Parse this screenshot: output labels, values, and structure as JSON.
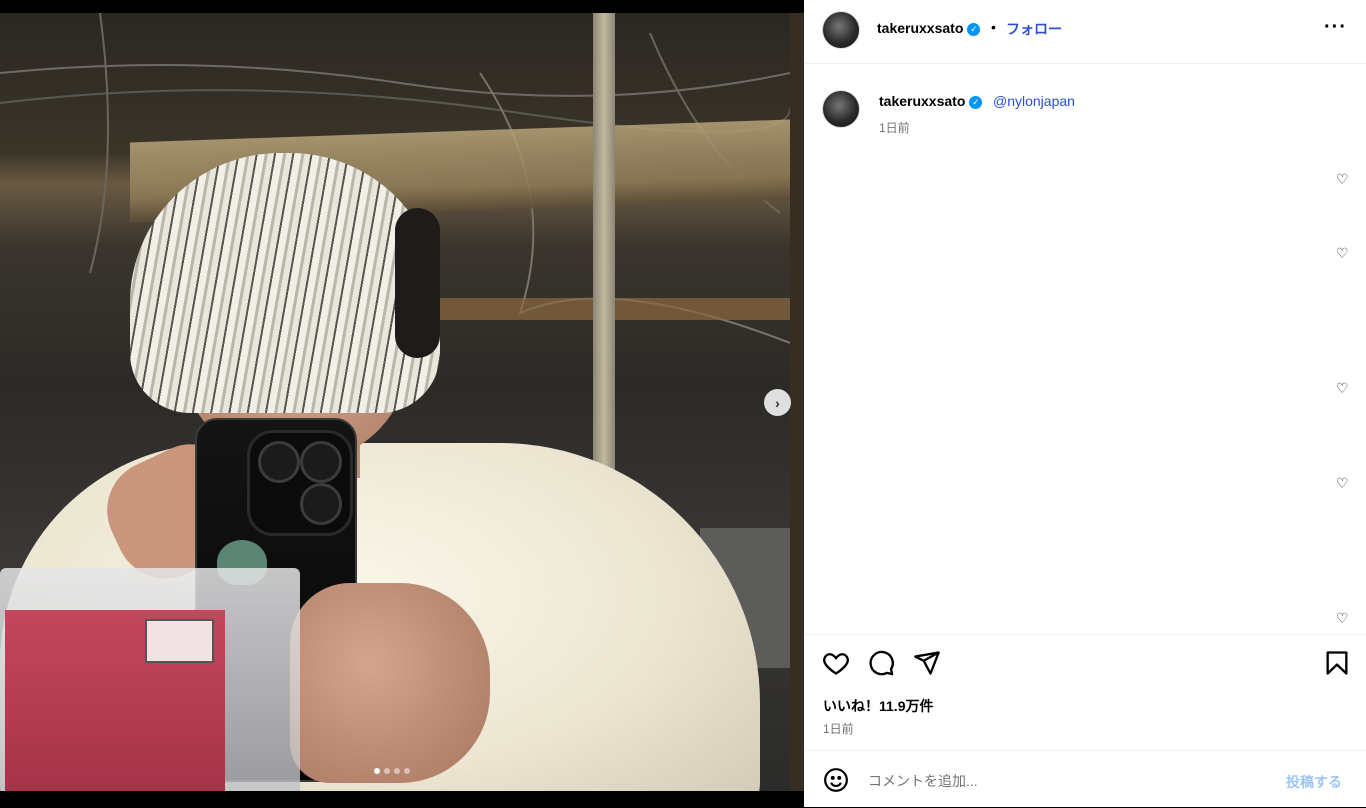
{
  "post": {
    "username": "takeruxxsato",
    "separator": "•",
    "follow_label": "フォロー",
    "more_icon": "more-horizontal-icon",
    "caption_mention": "@nylonjapan",
    "caption_time": "1日前",
    "likes": "いいね！11.9万件",
    "date": "1日前"
  },
  "media": {
    "next_icon": "chevron-right-icon",
    "next_glyph": "›",
    "carousel_count": 4,
    "carousel_active_index": 0
  },
  "comment": {
    "placeholder": "コメントを追加...",
    "post_label": "投稿する"
  },
  "colors": {
    "accent": "#0095f6",
    "link": "#2b4fd6",
    "post_disabled": "#9ec7f5"
  }
}
